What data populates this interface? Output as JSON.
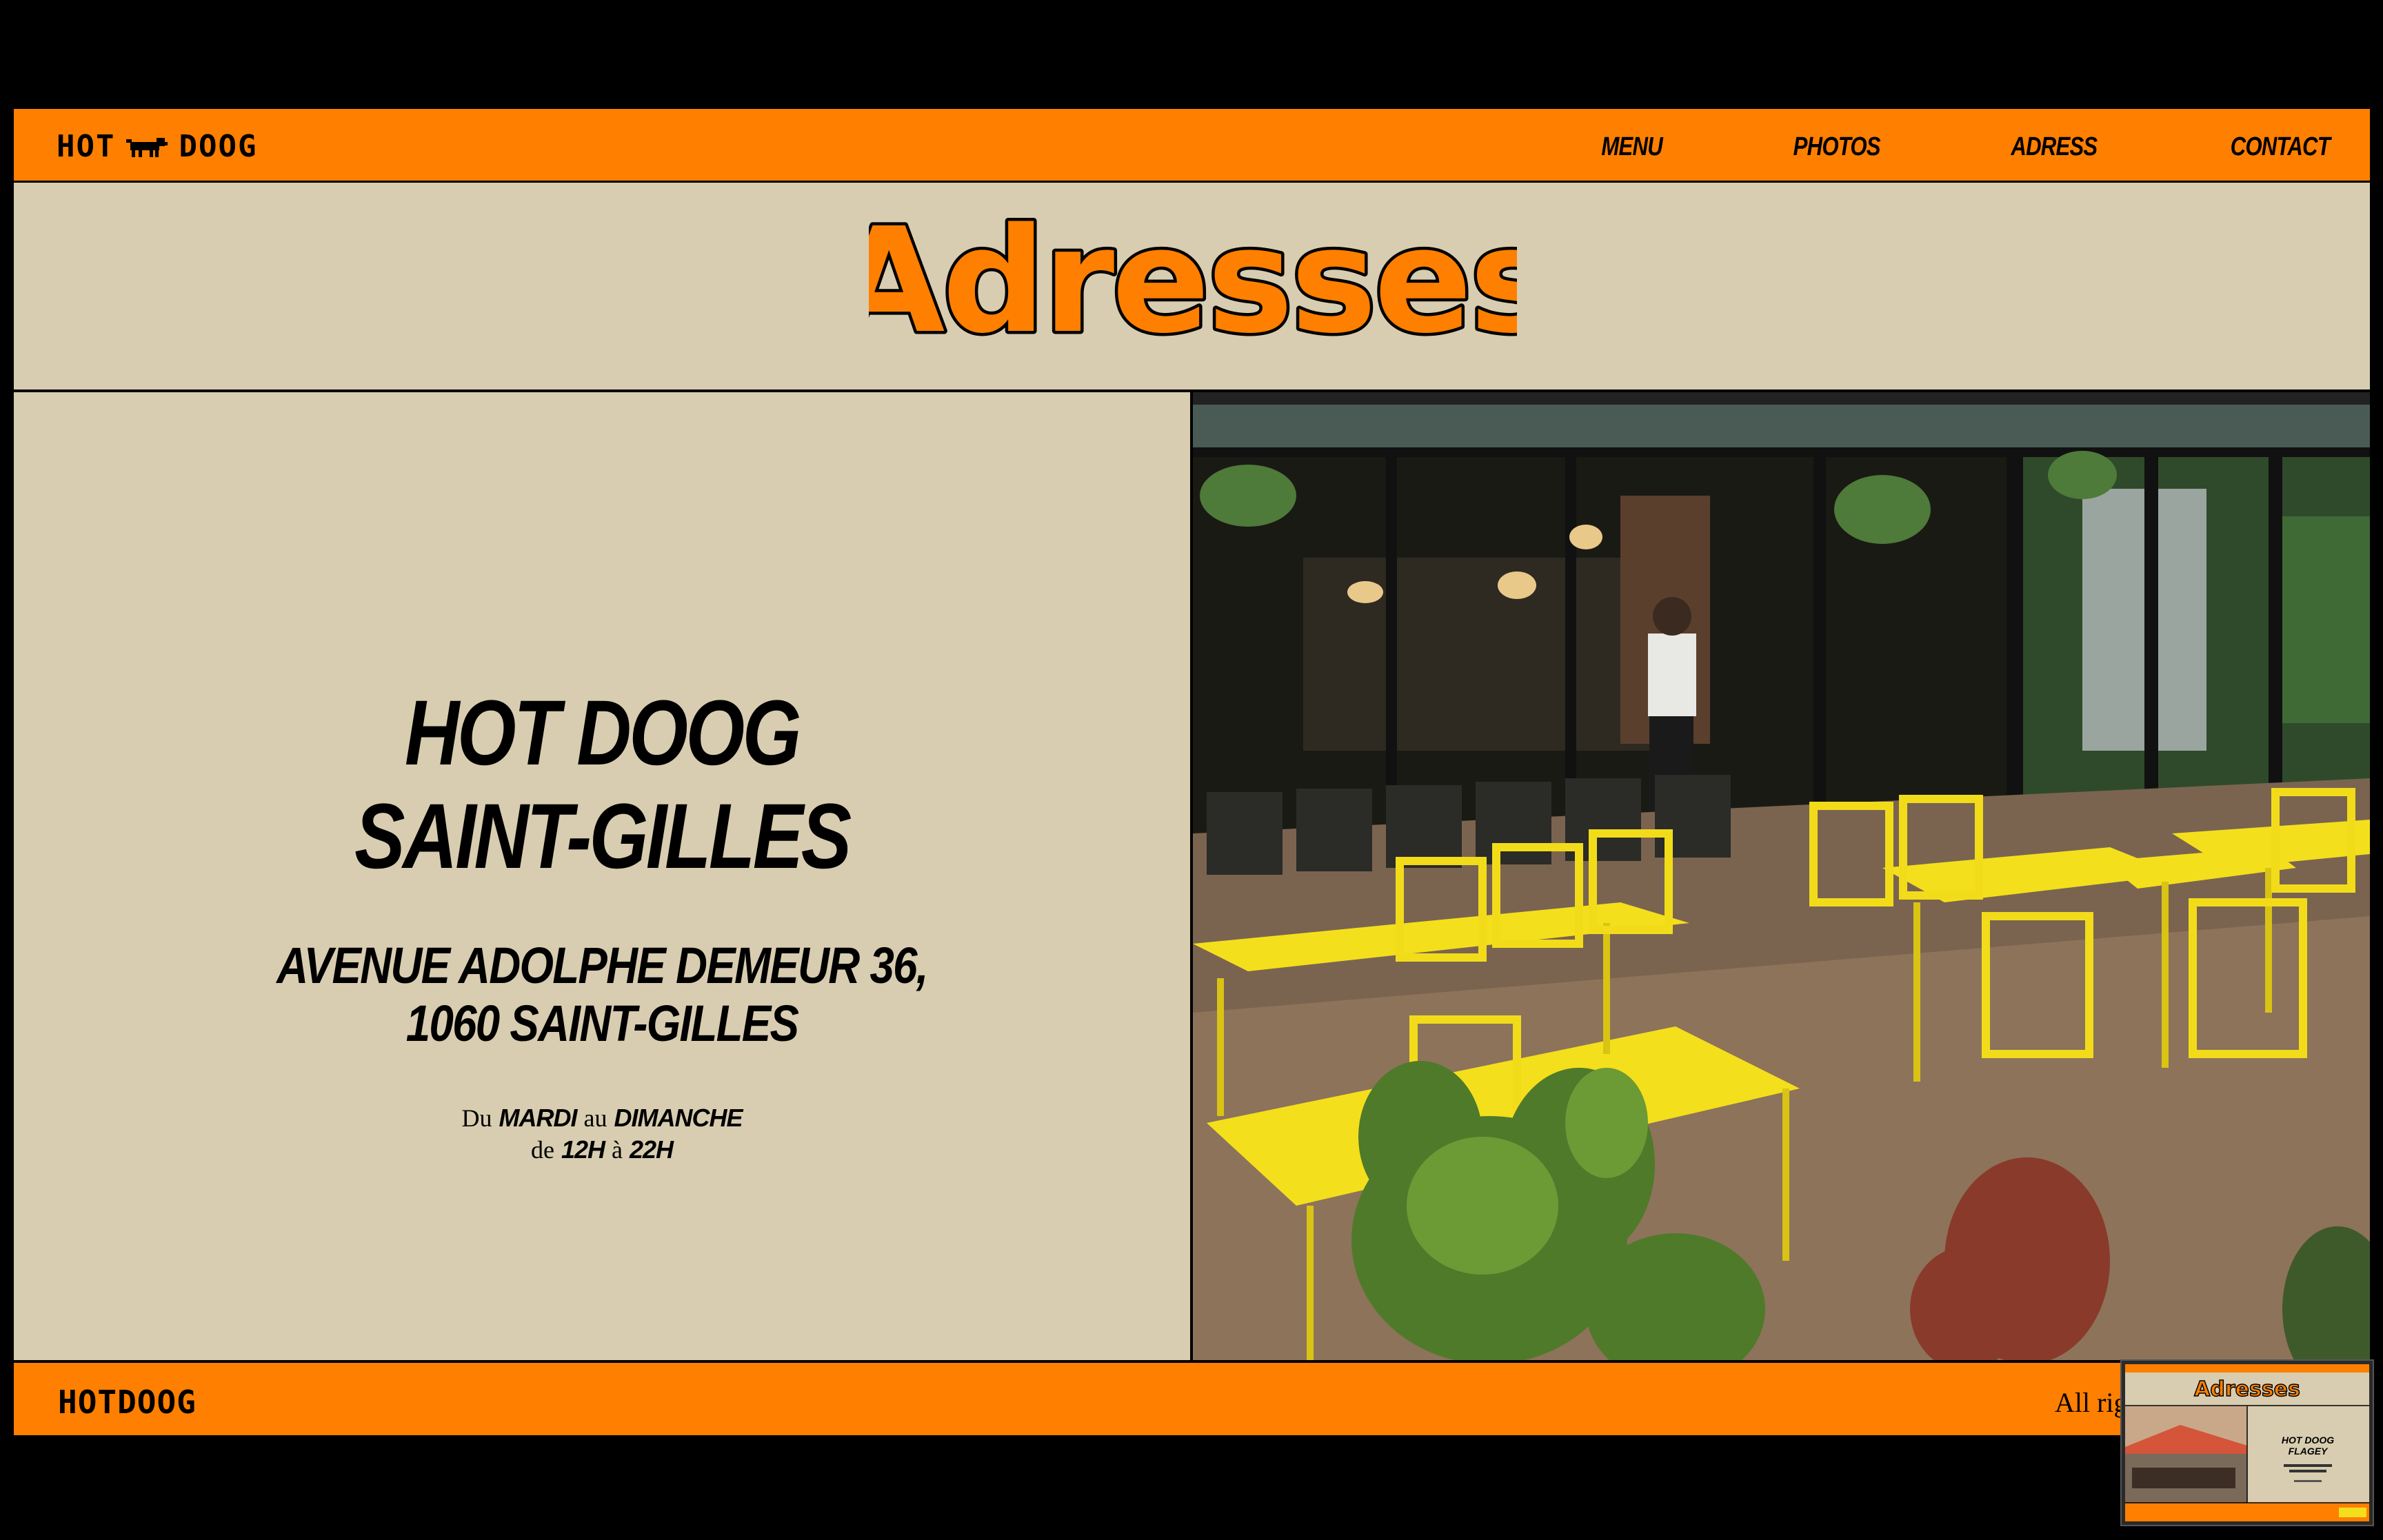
{
  "header": {
    "logo_left": "HOT",
    "logo_right": "DOOG",
    "nav": [
      "MENU",
      "PHOTOS",
      "ADRESS",
      "CONTACT"
    ]
  },
  "page": {
    "title": "Adresses"
  },
  "location": {
    "name_line1": "HOT DOOG",
    "name_line2": "SAINT-GILLES",
    "address_line1": "AVENUE ADOLPHE DEMEUR 36,",
    "address_line2": "1060 SAINT-GILLES",
    "hours": {
      "from_word": "Du",
      "from_day": "MARDI",
      "to_word": "au",
      "to_day": "DIMANCHE",
      "time_from_word": "de",
      "time_from": "12H",
      "time_to_word": "à",
      "time_to": "22H"
    }
  },
  "footer": {
    "logo": "HOTDOOG",
    "rights": "All rig"
  },
  "thumbnail": {
    "title": "Adresses",
    "name_line1": "HOT DOOG",
    "name_line2": "FLAGEY"
  },
  "colors": {
    "orange": "#ff7f00",
    "beige": "#d8cdb0",
    "black": "#000000",
    "yellow_furniture": "#f4df1c"
  },
  "icons": {
    "logo": "dachshund-icon"
  }
}
